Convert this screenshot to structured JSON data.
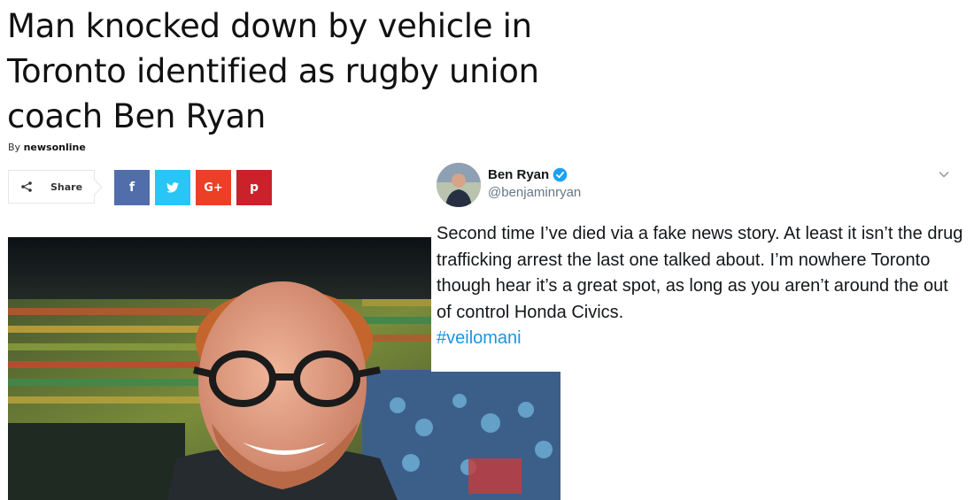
{
  "article": {
    "headline": "Man knocked down by vehicle in Toronto identified as rugby union coach Ben Ryan",
    "byline_prefix": "By",
    "byline_author": "newsonline"
  },
  "share_bar": {
    "share_label": "Share",
    "share_icon": "share-icon",
    "buttons": [
      {
        "name": "facebook",
        "glyph": "f",
        "color": "#516eab"
      },
      {
        "name": "twitter",
        "glyph": "twitter-bird",
        "color": "#29c5f6"
      },
      {
        "name": "google-plus",
        "glyph": "G+",
        "color": "#eb4026"
      },
      {
        "name": "pinterest",
        "glyph": "p",
        "color": "#ca212a"
      }
    ]
  },
  "tweet": {
    "name": "Ben Ryan",
    "handle": "@benjaminryan",
    "verified": true,
    "text": "Second time I’ve died via a fake news story. At least it isn’t the drug trafficking arrest the last one talked about. I’m nowhere Toronto though hear it’s a great spot, as long as you aren’t around the out of control Honda Civics.",
    "hashtag": "#veilomani",
    "link_color": "#1b95e0"
  },
  "photo": {
    "subject": "smiling man with red hair and glasses in a stadium crowd"
  }
}
